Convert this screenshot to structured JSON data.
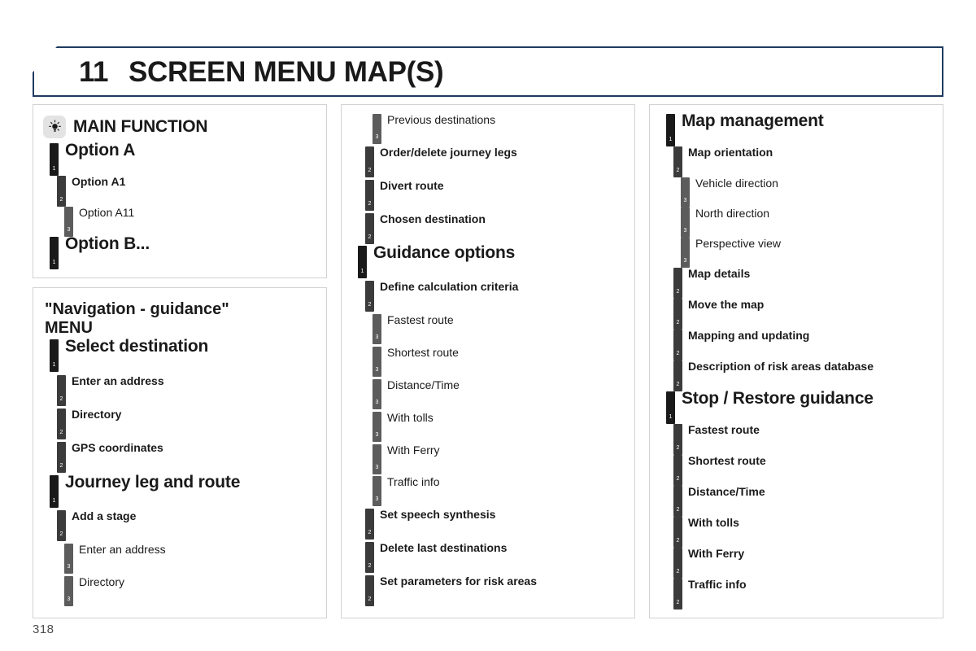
{
  "header": {
    "chapter_number": "11",
    "chapter_title": "SCREEN MENU MAP(S)",
    "border_color": "#1f3a5f"
  },
  "page_number": "318",
  "legend_colors": {
    "level1_bar": "#1a1a1a",
    "level2_bar": "#3b3b3b",
    "level3_bar": "#5c5c5c",
    "panel_border": "#d2d2d2",
    "badge_background": "#e3e3e3"
  },
  "columns": [
    {
      "panels": [
        {
          "id": "main-function",
          "heading_icon": "light-bulb-icon",
          "heading": "MAIN FUNCTION",
          "nodes": [
            {
              "level": 1,
              "label": "Option A"
            },
            {
              "level": 2,
              "label": "Option A1"
            },
            {
              "level": 3,
              "label": "Option A11"
            },
            {
              "level": 1,
              "label": "Option B..."
            }
          ]
        },
        {
          "id": "navigation-guidance-menu",
          "title": "\"Navigation - guidance\"\nMENU",
          "nodes": [
            {
              "level": 1,
              "label": "Select destination"
            },
            {
              "level": 2,
              "label": "Enter an address"
            },
            {
              "level": 2,
              "label": "Directory"
            },
            {
              "level": 2,
              "label": "GPS coordinates"
            },
            {
              "level": 1,
              "label": "Journey leg and route"
            },
            {
              "level": 2,
              "label": "Add a stage"
            },
            {
              "level": 3,
              "label": "Enter an address"
            },
            {
              "level": 3,
              "label": "Directory"
            }
          ]
        }
      ]
    },
    {
      "panels": [
        {
          "id": "guidance-continued",
          "nodes": [
            {
              "level": 3,
              "label": "Previous destinations"
            },
            {
              "level": 2,
              "label": "Order/delete journey legs"
            },
            {
              "level": 2,
              "label": "Divert route"
            },
            {
              "level": 2,
              "label": "Chosen destination"
            },
            {
              "level": 1,
              "label": "Guidance options"
            },
            {
              "level": 2,
              "label": "Define calculation criteria"
            },
            {
              "level": 3,
              "label": "Fastest route"
            },
            {
              "level": 3,
              "label": "Shortest route"
            },
            {
              "level": 3,
              "label": "Distance/Time"
            },
            {
              "level": 3,
              "label": "With tolls"
            },
            {
              "level": 3,
              "label": "With Ferry"
            },
            {
              "level": 3,
              "label": "Traffic info"
            },
            {
              "level": 2,
              "label": "Set speech synthesis"
            },
            {
              "level": 2,
              "label": "Delete last destinations"
            },
            {
              "level": 2,
              "label": "Set parameters for risk areas"
            }
          ]
        }
      ]
    },
    {
      "panels": [
        {
          "id": "map-management",
          "nodes": [
            {
              "level": 1,
              "label": "Map management"
            },
            {
              "level": 2,
              "label": "Map orientation"
            },
            {
              "level": 3,
              "label": "Vehicle direction"
            },
            {
              "level": 3,
              "label": "North direction"
            },
            {
              "level": 3,
              "label": "Perspective view"
            },
            {
              "level": 2,
              "label": "Map details"
            },
            {
              "level": 2,
              "label": "Move the map"
            },
            {
              "level": 2,
              "label": "Mapping and updating"
            },
            {
              "level": 2,
              "label": "Description of risk areas database"
            },
            {
              "level": 1,
              "label": "Stop / Restore guidance"
            },
            {
              "level": 2,
              "label": "Fastest route"
            },
            {
              "level": 2,
              "label": "Shortest route"
            },
            {
              "level": 2,
              "label": "Distance/Time"
            },
            {
              "level": 2,
              "label": "With tolls"
            },
            {
              "level": 2,
              "label": "With Ferry"
            },
            {
              "level": 2,
              "label": "Traffic info"
            }
          ]
        }
      ]
    }
  ]
}
